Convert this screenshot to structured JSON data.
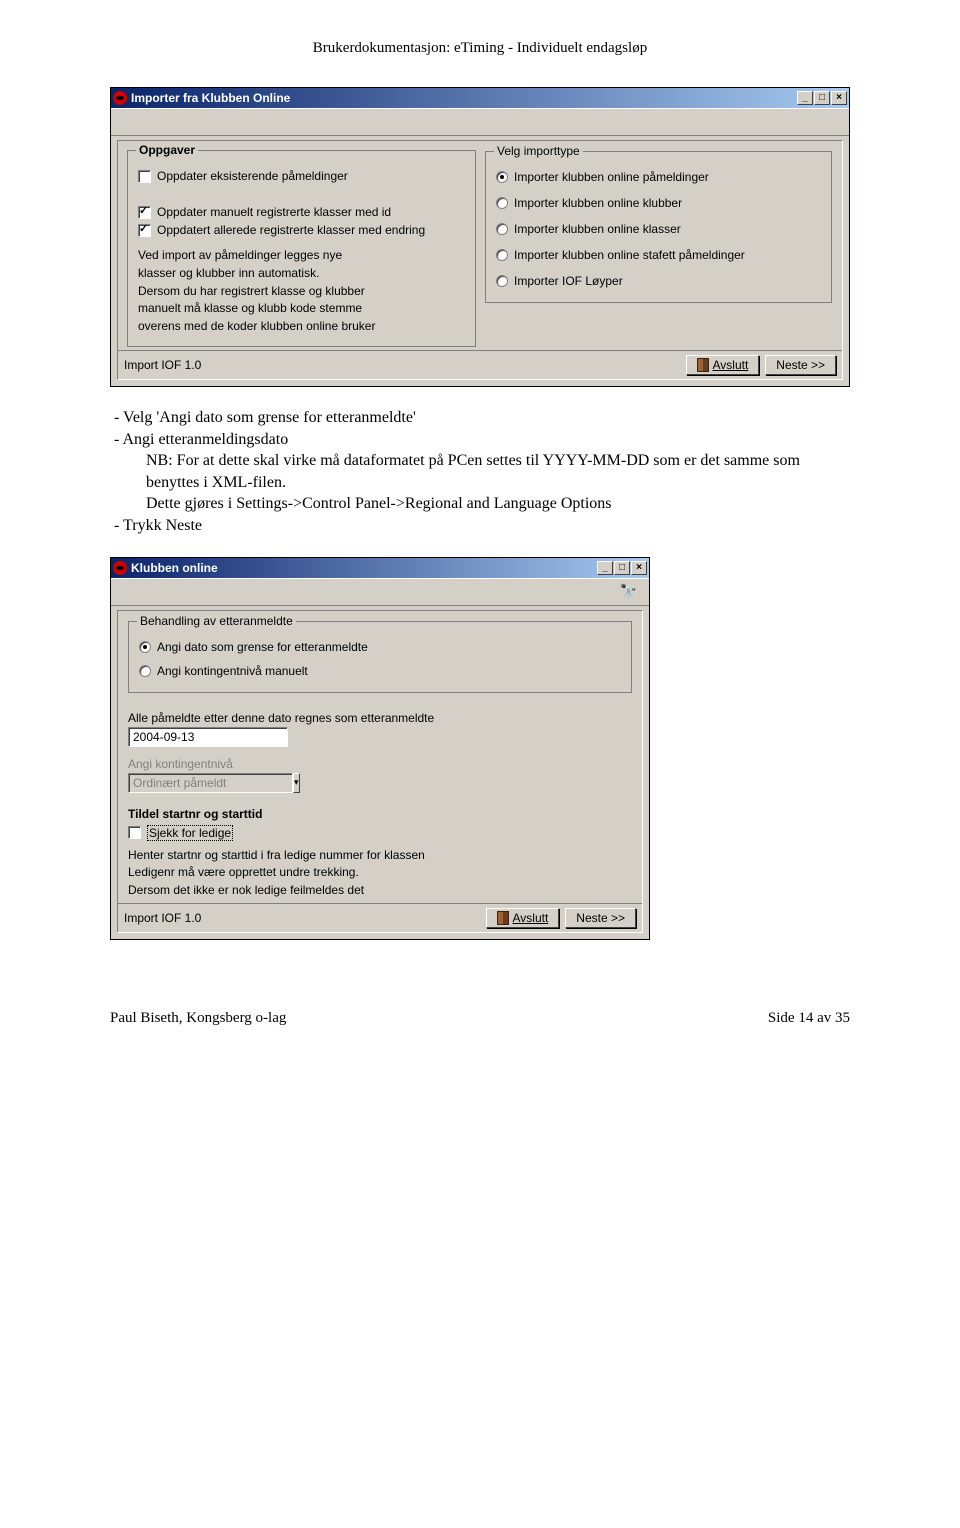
{
  "doc_header": "Brukerdokumentasjon: eTiming - Individuelt endagsløp",
  "win1": {
    "title": "Importer fra Klubben Online",
    "oppgaver": {
      "legend": "Oppgaver",
      "chk1": "Oppdater eksisterende påmeldinger",
      "chk2": "Oppdater manuelt registrerte klasser med id",
      "chk3": "Oppdatert allerede registrerte klasser med endring",
      "chk1_checked": false,
      "chk2_checked": true,
      "chk3_checked": true,
      "info1": "Ved import av påmeldinger legges nye",
      "info2": "klasser og klubber inn automatisk.",
      "info3": "Dersom du har registrert klasse og klubber",
      "info4": "manuelt må klasse og klubb kode stemme",
      "info5": "overens med de koder klubben online bruker"
    },
    "importtype": {
      "legend": "Velg importtype",
      "r1": "Importer klubben online påmeldinger",
      "r2": "Importer klubben online klubber",
      "r3": "Importer klubben online klasser",
      "r4": "Importer klubben online stafett påmeldinger",
      "r5": "Importer IOF Løyper"
    },
    "status": "Import   IOF 1.0",
    "avslutt": "Avslutt",
    "neste": "Neste >>"
  },
  "body": {
    "l1": "Velg 'Angi dato som grense for etteranmeldte'",
    "l2": "Angi etteranmeldingsdato",
    "l3": "NB: For at dette skal virke må dataformatet på PCen settes til YYYY-MM-DD som er det samme som benyttes i XML-filen.",
    "l4": "Dette gjøres i Settings->Control Panel->Regional and Language Options",
    "l5": "Trykk Neste"
  },
  "win2": {
    "title": "Klubben online",
    "etter": {
      "legend": "Behandling av etteranmeldte",
      "r1": "Angi dato som grense for etteranmeldte",
      "r2": "Angi kontingentnivå manuelt"
    },
    "date_label": "Alle påmeldte etter denne dato regnes som etteranmeldte",
    "date_value": "2004-09-13",
    "kont_label": "Angi kontingentnivå",
    "kont_value": "Ordinært påmeldt",
    "tildel": {
      "legend": "Tildel startnr og starttid",
      "chk": "Sjekk for ledige",
      "i1": "Henter startnr og starttid i fra ledige nummer for klassen",
      "i2": "Ledigenr må være opprettet undre trekking.",
      "i3": "Dersom det ikke er nok ledige feilmeldes det"
    },
    "status": "Import   IOF 1.0",
    "avslutt": "Avslutt",
    "neste": "Neste >>"
  },
  "footer": {
    "left": "Paul Biseth, Kongsberg o-lag",
    "right": "Side 14 av 35"
  }
}
